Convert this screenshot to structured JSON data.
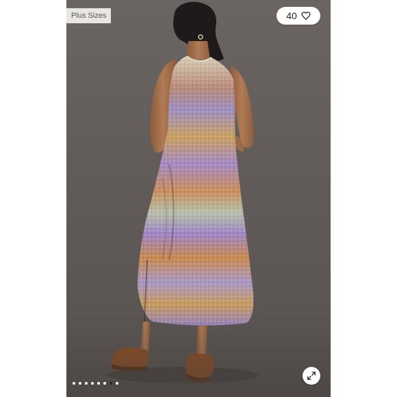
{
  "listing": {
    "badge_label": "Plus Sizes",
    "like_count": "40",
    "heart_icon": "heart-outline-icon",
    "expand_icon": "expand-arrows-icon"
  },
  "carousel": {
    "total_images": 8,
    "active_index": 6
  },
  "colors": {
    "backdrop": "#615b59",
    "badge_bg": "#e8e6e4",
    "button_bg": "#ffffff",
    "dot_inactive": "#ffffff",
    "dot_active": "#2a2a2a"
  }
}
